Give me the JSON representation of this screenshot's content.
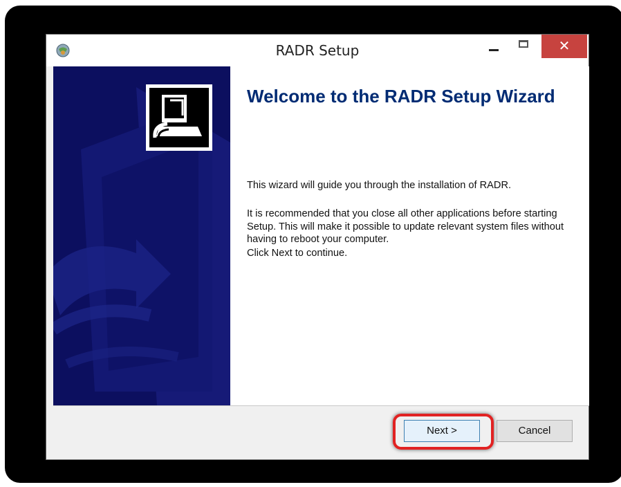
{
  "window": {
    "title": "RADR Setup",
    "minimize_label": "",
    "maximize_label": "",
    "close_label": "✕"
  },
  "welcome": {
    "heading": "Welcome to the RADR Setup Wizard",
    "intro": "This wizard will guide you through the installation of RADR.",
    "recommendation": "It is recommended that you close all other applications before starting Setup. This will make it possible to update relevant system files without having to reboot your computer.",
    "continue_hint": "Click Next to continue."
  },
  "buttons": {
    "next_label": "Next >",
    "cancel_label": "Cancel"
  },
  "colors": {
    "side_panel": "#0c0f5f",
    "heading": "#002b73",
    "close_button": "#c7433f",
    "highlight": "#e12222"
  }
}
